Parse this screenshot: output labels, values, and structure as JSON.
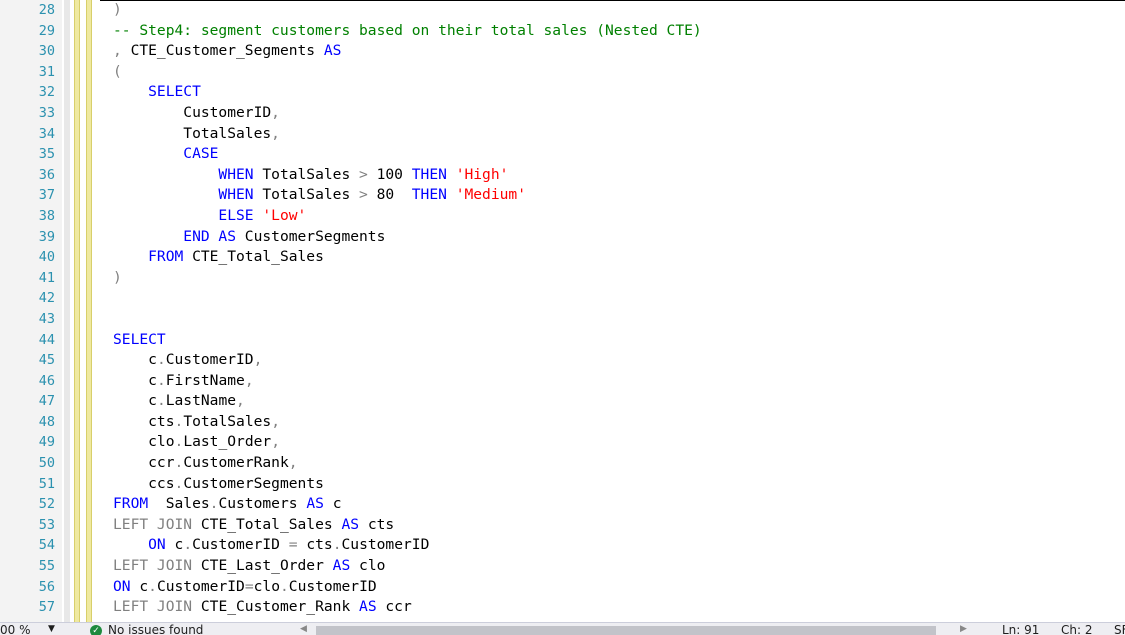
{
  "editor": {
    "lines": [
      {
        "num": "28",
        "tokens": [
          {
            "t": ")",
            "c": "gray"
          }
        ]
      },
      {
        "num": "29",
        "tokens": [
          {
            "t": "-- Step4: segment customers based on their total sales (Nested CTE)",
            "c": "cm"
          }
        ]
      },
      {
        "num": "30",
        "tokens": [
          {
            "t": ", ",
            "c": "gray"
          },
          {
            "t": "CTE_Customer_Segments ",
            "c": "plain"
          },
          {
            "t": "AS",
            "c": "kw"
          }
        ]
      },
      {
        "num": "31",
        "tokens": [
          {
            "t": "(",
            "c": "gray"
          }
        ]
      },
      {
        "num": "32",
        "tokens": [
          {
            "t": "    SELECT",
            "c": "kw"
          }
        ]
      },
      {
        "num": "33",
        "tokens": [
          {
            "t": "        CustomerID",
            "c": "plain"
          },
          {
            "t": ",",
            "c": "gray"
          }
        ]
      },
      {
        "num": "34",
        "tokens": [
          {
            "t": "        TotalSales",
            "c": "plain"
          },
          {
            "t": ",",
            "c": "gray"
          }
        ]
      },
      {
        "num": "35",
        "tokens": [
          {
            "t": "        CASE",
            "c": "kw"
          }
        ]
      },
      {
        "num": "36",
        "tokens": [
          {
            "t": "            WHEN ",
            "c": "kw"
          },
          {
            "t": "TotalSales ",
            "c": "plain"
          },
          {
            "t": "> ",
            "c": "gray"
          },
          {
            "t": "100 ",
            "c": "plain"
          },
          {
            "t": "THEN ",
            "c": "kw"
          },
          {
            "t": "'High'",
            "c": "str"
          }
        ]
      },
      {
        "num": "37",
        "tokens": [
          {
            "t": "            WHEN ",
            "c": "kw"
          },
          {
            "t": "TotalSales ",
            "c": "plain"
          },
          {
            "t": "> ",
            "c": "gray"
          },
          {
            "t": "80  ",
            "c": "plain"
          },
          {
            "t": "THEN ",
            "c": "kw"
          },
          {
            "t": "'Medium'",
            "c": "str"
          }
        ]
      },
      {
        "num": "38",
        "tokens": [
          {
            "t": "            ELSE ",
            "c": "kw"
          },
          {
            "t": "'Low'",
            "c": "str"
          }
        ]
      },
      {
        "num": "39",
        "tokens": [
          {
            "t": "        END AS ",
            "c": "kw"
          },
          {
            "t": "CustomerSegments",
            "c": "plain"
          }
        ]
      },
      {
        "num": "40",
        "tokens": [
          {
            "t": "    FROM ",
            "c": "kw"
          },
          {
            "t": "CTE_Total_Sales",
            "c": "plain"
          }
        ]
      },
      {
        "num": "41",
        "tokens": [
          {
            "t": ")",
            "c": "gray"
          }
        ]
      },
      {
        "num": "42",
        "tokens": []
      },
      {
        "num": "43",
        "tokens": []
      },
      {
        "num": "44",
        "tokens": [
          {
            "t": "SELECT",
            "c": "kw"
          }
        ]
      },
      {
        "num": "45",
        "tokens": [
          {
            "t": "    c",
            "c": "plain"
          },
          {
            "t": ".",
            "c": "gray"
          },
          {
            "t": "CustomerID",
            "c": "plain"
          },
          {
            "t": ",",
            "c": "gray"
          }
        ]
      },
      {
        "num": "46",
        "tokens": [
          {
            "t": "    c",
            "c": "plain"
          },
          {
            "t": ".",
            "c": "gray"
          },
          {
            "t": "FirstName",
            "c": "plain"
          },
          {
            "t": ",",
            "c": "gray"
          }
        ]
      },
      {
        "num": "47",
        "tokens": [
          {
            "t": "    c",
            "c": "plain"
          },
          {
            "t": ".",
            "c": "gray"
          },
          {
            "t": "LastName",
            "c": "plain"
          },
          {
            "t": ",",
            "c": "gray"
          }
        ]
      },
      {
        "num": "48",
        "tokens": [
          {
            "t": "    cts",
            "c": "plain"
          },
          {
            "t": ".",
            "c": "gray"
          },
          {
            "t": "TotalSales",
            "c": "plain"
          },
          {
            "t": ",",
            "c": "gray"
          }
        ]
      },
      {
        "num": "49",
        "tokens": [
          {
            "t": "    clo",
            "c": "plain"
          },
          {
            "t": ".",
            "c": "gray"
          },
          {
            "t": "Last_Order",
            "c": "plain"
          },
          {
            "t": ",",
            "c": "gray"
          }
        ]
      },
      {
        "num": "50",
        "tokens": [
          {
            "t": "    ccr",
            "c": "plain"
          },
          {
            "t": ".",
            "c": "gray"
          },
          {
            "t": "CustomerRank",
            "c": "plain"
          },
          {
            "t": ",",
            "c": "gray"
          }
        ]
      },
      {
        "num": "51",
        "tokens": [
          {
            "t": "    ccs",
            "c": "plain"
          },
          {
            "t": ".",
            "c": "gray"
          },
          {
            "t": "CustomerSegments",
            "c": "plain"
          }
        ]
      },
      {
        "num": "52",
        "tokens": [
          {
            "t": "FROM  ",
            "c": "kw"
          },
          {
            "t": "Sales",
            "c": "plain"
          },
          {
            "t": ".",
            "c": "gray"
          },
          {
            "t": "Customers ",
            "c": "plain"
          },
          {
            "t": "AS ",
            "c": "kw"
          },
          {
            "t": "c",
            "c": "plain"
          }
        ]
      },
      {
        "num": "53",
        "tokens": [
          {
            "t": "LEFT JOIN ",
            "c": "gray"
          },
          {
            "t": "CTE_Total_Sales ",
            "c": "plain"
          },
          {
            "t": "AS ",
            "c": "kw"
          },
          {
            "t": "cts",
            "c": "plain"
          }
        ]
      },
      {
        "num": "54",
        "tokens": [
          {
            "t": "    ON ",
            "c": "kw"
          },
          {
            "t": "c",
            "c": "plain"
          },
          {
            "t": ".",
            "c": "gray"
          },
          {
            "t": "CustomerID ",
            "c": "plain"
          },
          {
            "t": "= ",
            "c": "gray"
          },
          {
            "t": "cts",
            "c": "plain"
          },
          {
            "t": ".",
            "c": "gray"
          },
          {
            "t": "CustomerID",
            "c": "plain"
          }
        ]
      },
      {
        "num": "55",
        "tokens": [
          {
            "t": "LEFT JOIN ",
            "c": "gray"
          },
          {
            "t": "CTE_Last_Order ",
            "c": "plain"
          },
          {
            "t": "AS ",
            "c": "kw"
          },
          {
            "t": "clo",
            "c": "plain"
          }
        ]
      },
      {
        "num": "56",
        "tokens": [
          {
            "t": "ON ",
            "c": "kw"
          },
          {
            "t": "c",
            "c": "plain"
          },
          {
            "t": ".",
            "c": "gray"
          },
          {
            "t": "CustomerID",
            "c": "plain"
          },
          {
            "t": "=",
            "c": "gray"
          },
          {
            "t": "clo",
            "c": "plain"
          },
          {
            "t": ".",
            "c": "gray"
          },
          {
            "t": "CustomerID",
            "c": "plain"
          }
        ]
      },
      {
        "num": "57",
        "tokens": [
          {
            "t": "LEFT JOIN ",
            "c": "gray"
          },
          {
            "t": "CTE_Customer_Rank ",
            "c": "plain"
          },
          {
            "t": "AS ",
            "c": "kw"
          },
          {
            "t": "ccr",
            "c": "plain"
          }
        ]
      }
    ]
  },
  "statusbar": {
    "zoom": "00 %",
    "zoom_arrow": "▼",
    "ok_icon": "✓",
    "issues": "No issues found",
    "scroll_left": "◀",
    "scroll_right": "▶",
    "ln": "Ln: 91",
    "ch": "Ch: 2",
    "extra": "SF"
  },
  "colors": {
    "keyword": "#0000ff",
    "comment": "#008000",
    "string": "#ff0000",
    "operator": "#808080",
    "line_number": "#2b91af"
  },
  "icons": {
    "status_ok": "check-circle-icon",
    "zoom_dropdown": "chevron-down-icon",
    "scroll_left": "scroll-left-icon",
    "scroll_right": "scroll-right-icon"
  }
}
